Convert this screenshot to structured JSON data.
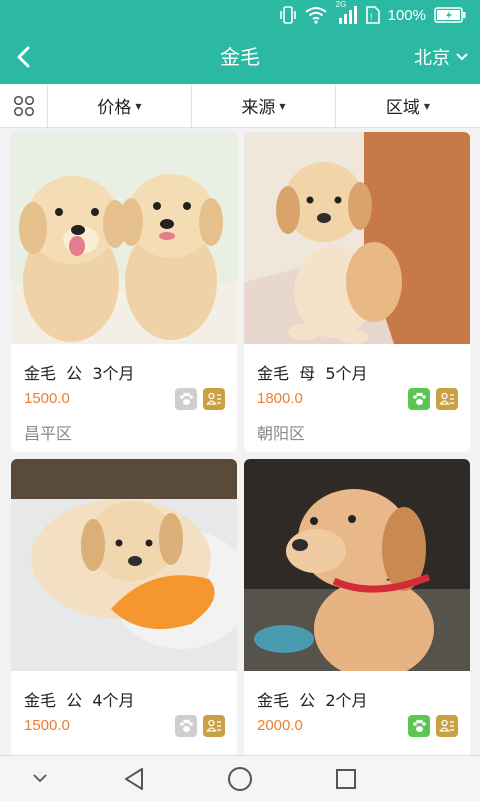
{
  "status_bar": {
    "network": "2G",
    "battery_text": "100%"
  },
  "header": {
    "title": "金毛",
    "city": "北京"
  },
  "filters": [
    {
      "label": "价格"
    },
    {
      "label": "来源"
    },
    {
      "label": "区域"
    }
  ],
  "listings": [
    {
      "name": "金毛  公  3个月",
      "price": "1500.0",
      "area": "昌平区",
      "paw_badge": "grey",
      "cert_badge": "gold"
    },
    {
      "name": "金毛  母  5个月",
      "price": "1800.0",
      "area": "朝阳区",
      "paw_badge": "green",
      "cert_badge": "gold"
    },
    {
      "name": "金毛  公  4个月",
      "price": "1500.0",
      "area": "",
      "paw_badge": "grey",
      "cert_badge": "gold"
    },
    {
      "name": "金毛  公  2个月",
      "price": "2000.0",
      "area": "",
      "paw_badge": "green",
      "cert_badge": "gold"
    }
  ],
  "colors": {
    "accent": "#2bb9a4",
    "price": "#ef7d2d",
    "badge_green": "#5cc653",
    "badge_gold": "#c9a142",
    "badge_grey": "#cfcfcf"
  },
  "icons": [
    "vibrate-icon",
    "wifi-icon",
    "signal-icon",
    "sim-icon",
    "battery-icon",
    "back-icon",
    "chevron-down-icon",
    "grid-view-icon",
    "paw-icon",
    "certificate-icon",
    "nav-back-icon",
    "home-icon",
    "recents-icon",
    "hide-nav-icon"
  ]
}
